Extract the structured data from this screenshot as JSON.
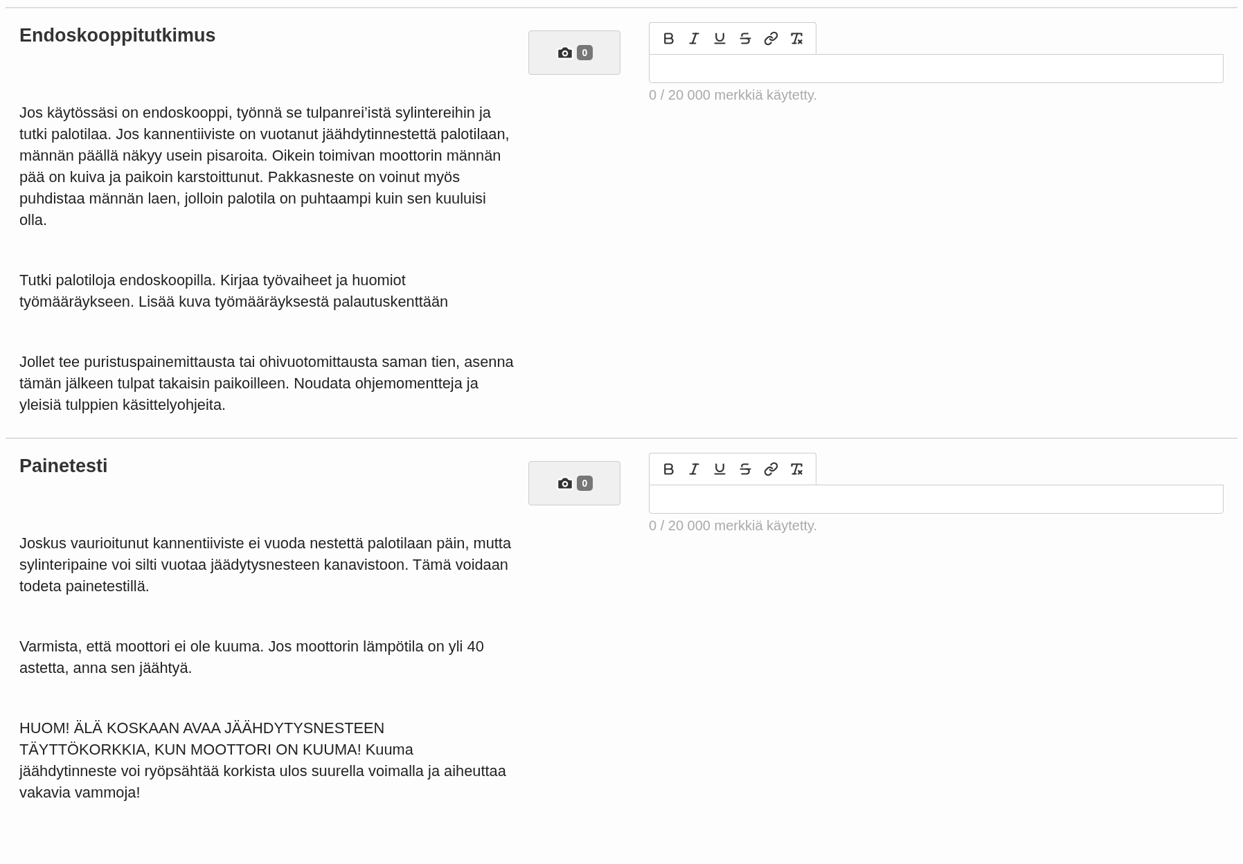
{
  "sections": [
    {
      "title": "Endoskooppitutkimus",
      "photo_count": "0",
      "counter": "0 / 20 000 merkkiä käytetty.",
      "paragraphs": [
        "Jos käytössäsi on endoskooppi, työnnä se tulpanrei’istä sylintereihin ja tutki palotilaa. Jos kannentiiviste on vuotanut jäähdytinnestettä palotilaan, männän päällä näkyy usein pisaroita. Oikein toimivan moottorin männän pää on kuiva ja paikoin karstoittunut. Pakkasneste on voinut myös puhdistaa männän laen, jolloin palotila on puhtaampi kuin sen kuuluisi olla.",
        "Tutki palotiloja endoskoopilla. Kirjaa työvaiheet ja huomiot työmääräykseen. Lisää kuva työmääräyksestä palautuskenttään",
        "Jollet tee puristuspainemittausta tai ohivuotomittausta saman tien, asenna tämän jälkeen tulpat takaisin paikoilleen. Noudata ohjemomentteja ja yleisiä tulppien käsittelyohjeita."
      ]
    },
    {
      "title": "Painetesti",
      "photo_count": "0",
      "counter": "0 / 20 000 merkkiä käytetty.",
      "paragraphs": [
        "Joskus vaurioitunut kannentiiviste ei vuoda nestettä palotilaan päin, mutta sylinteripaine voi silti vuotaa jäädytysnesteen kanavistoon. Tämä voidaan todeta painetestillä.",
        "Varmista, että moottori ei ole kuuma. Jos moottorin lämpötila on yli 40 astetta, anna sen jäähtyä.",
        "HUOM! ÄLÄ KOSKAAN AVAA JÄÄHDYTYSNESTEEN TÄYTTÖKORKKIA, KUN MOOTTORI ON KUUMA! Kuuma jäähdytinneste voi ryöpsähtää korkista ulos suurella voimalla ja aiheuttaa vakavia vammoja!"
      ]
    }
  ]
}
